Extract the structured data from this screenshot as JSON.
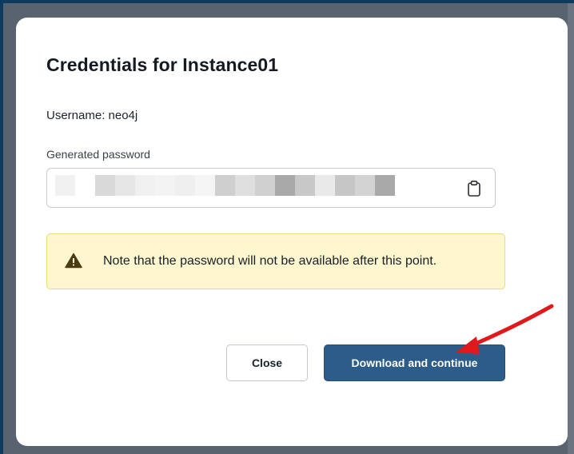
{
  "dialog": {
    "title": "Credentials for Instance01",
    "username_text": "Username: neo4j",
    "password_label": "Generated password",
    "password_pixels": [
      "#f1f1f1",
      "#ffffff",
      "#d9d9d9",
      "#e6e6e6",
      "#f0f0f0",
      "#f3f3f3",
      "#efefef",
      "#f5f5f5",
      "#cfcfcf",
      "#dedede",
      "#d0d0d0",
      "#a8a8a8",
      "#c8c8c8",
      "#e9e9e9",
      "#c6c6c6",
      "#d3d3d3",
      "#a9a9a9"
    ],
    "copy_icon": "clipboard-icon",
    "note_text": "Note that the password will not be available after this point.",
    "note_icon": "warning-icon",
    "buttons": {
      "close": "Close",
      "download": "Download and continue"
    }
  },
  "colors": {
    "primary": "#2b5c8a",
    "note_bg": "#fdf6cf",
    "note_border": "#eadb7c",
    "warning_icon": "#4b3b12",
    "annotation_arrow": "#e0191c"
  }
}
